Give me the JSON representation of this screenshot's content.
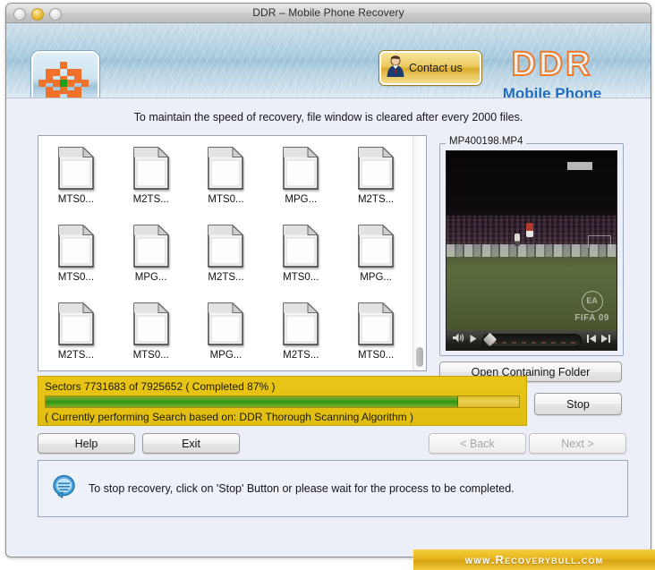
{
  "window": {
    "title": "DDR – Mobile Phone Recovery",
    "controls": [
      {
        "name": "close",
        "state": "inactive"
      },
      {
        "name": "minimize",
        "state": "active"
      },
      {
        "name": "zoom",
        "state": "inactive"
      }
    ]
  },
  "header": {
    "app_icon_name": "ddr-app-icon",
    "contact_button": "Contact us",
    "brand_title": "DDR",
    "brand_subtitle": "Mobile Phone",
    "brand_color": "#f2792a",
    "subtitle_color": "#1f6bbf"
  },
  "main": {
    "notice": "To maintain the speed of recovery, file window is cleared after every 2000 files.",
    "file_rows": [
      [
        "MTS0...",
        "M2TS...",
        "MTS0...",
        "MPG...",
        "M2TS..."
      ],
      [
        "MTS0...",
        "MPG...",
        "M2TS...",
        "MTS0...",
        "MPG..."
      ],
      [
        "M2TS...",
        "MTS0...",
        "MPG...",
        "M2TS...",
        "MTS0..."
      ]
    ],
    "preview": {
      "filename": "MP400198.MP4",
      "watermark_ea": "EA",
      "watermark_game": "FIFA 09",
      "player_controls": [
        {
          "name": "volume-icon",
          "glyph": "speaker"
        },
        {
          "name": "play-button",
          "glyph": "play"
        },
        {
          "name": "scrub-handle",
          "glyph": "diamond"
        },
        {
          "name": "step-back-button",
          "glyph": "step-back"
        },
        {
          "name": "step-forward-button",
          "glyph": "step-forward"
        }
      ]
    },
    "open_folder_button": "Open Containing Folder"
  },
  "progress": {
    "line1": "Sectors 7731683 of 7925652   ( Completed 87% )",
    "line2": "( Currently performing Search based on: DDR Thorough Scanning Algorithm )",
    "percent": 87,
    "sectors_done": 7731683,
    "sectors_total": 7925652,
    "panel_color": "#e5c014",
    "bar_color": "#2f9412"
  },
  "buttons": {
    "stop": "Stop",
    "help": "Help",
    "exit": "Exit",
    "back": "< Back",
    "next": "Next >"
  },
  "status": {
    "icon_name": "speech-bubble-icon",
    "message": "To stop recovery, click on 'Stop' Button or please wait for the process to be completed."
  },
  "footer": {
    "watermark": "www.Recoverybull.com"
  }
}
